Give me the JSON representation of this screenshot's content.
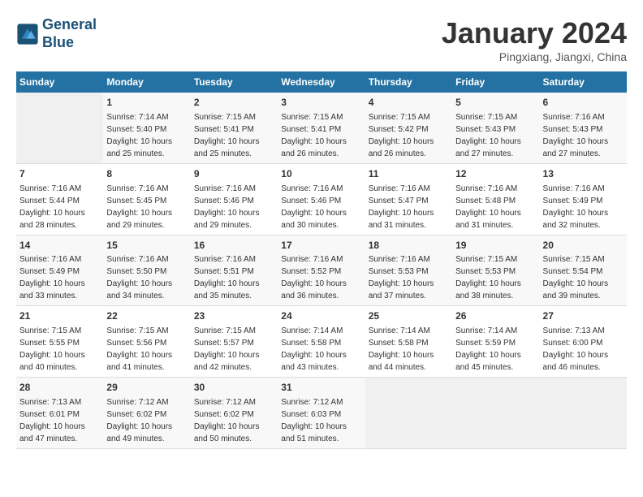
{
  "header": {
    "logo_line1": "General",
    "logo_line2": "Blue",
    "month": "January 2024",
    "location": "Pingxiang, Jiangxi, China"
  },
  "weekdays": [
    "Sunday",
    "Monday",
    "Tuesday",
    "Wednesday",
    "Thursday",
    "Friday",
    "Saturday"
  ],
  "weeks": [
    [
      {
        "day": "",
        "sunrise": "",
        "sunset": "",
        "daylight": ""
      },
      {
        "day": "1",
        "sunrise": "Sunrise: 7:14 AM",
        "sunset": "Sunset: 5:40 PM",
        "daylight": "Daylight: 10 hours and 25 minutes."
      },
      {
        "day": "2",
        "sunrise": "Sunrise: 7:15 AM",
        "sunset": "Sunset: 5:41 PM",
        "daylight": "Daylight: 10 hours and 25 minutes."
      },
      {
        "day": "3",
        "sunrise": "Sunrise: 7:15 AM",
        "sunset": "Sunset: 5:41 PM",
        "daylight": "Daylight: 10 hours and 26 minutes."
      },
      {
        "day": "4",
        "sunrise": "Sunrise: 7:15 AM",
        "sunset": "Sunset: 5:42 PM",
        "daylight": "Daylight: 10 hours and 26 minutes."
      },
      {
        "day": "5",
        "sunrise": "Sunrise: 7:15 AM",
        "sunset": "Sunset: 5:43 PM",
        "daylight": "Daylight: 10 hours and 27 minutes."
      },
      {
        "day": "6",
        "sunrise": "Sunrise: 7:16 AM",
        "sunset": "Sunset: 5:43 PM",
        "daylight": "Daylight: 10 hours and 27 minutes."
      }
    ],
    [
      {
        "day": "7",
        "sunrise": "Sunrise: 7:16 AM",
        "sunset": "Sunset: 5:44 PM",
        "daylight": "Daylight: 10 hours and 28 minutes."
      },
      {
        "day": "8",
        "sunrise": "Sunrise: 7:16 AM",
        "sunset": "Sunset: 5:45 PM",
        "daylight": "Daylight: 10 hours and 29 minutes."
      },
      {
        "day": "9",
        "sunrise": "Sunrise: 7:16 AM",
        "sunset": "Sunset: 5:46 PM",
        "daylight": "Daylight: 10 hours and 29 minutes."
      },
      {
        "day": "10",
        "sunrise": "Sunrise: 7:16 AM",
        "sunset": "Sunset: 5:46 PM",
        "daylight": "Daylight: 10 hours and 30 minutes."
      },
      {
        "day": "11",
        "sunrise": "Sunrise: 7:16 AM",
        "sunset": "Sunset: 5:47 PM",
        "daylight": "Daylight: 10 hours and 31 minutes."
      },
      {
        "day": "12",
        "sunrise": "Sunrise: 7:16 AM",
        "sunset": "Sunset: 5:48 PM",
        "daylight": "Daylight: 10 hours and 31 minutes."
      },
      {
        "day": "13",
        "sunrise": "Sunrise: 7:16 AM",
        "sunset": "Sunset: 5:49 PM",
        "daylight": "Daylight: 10 hours and 32 minutes."
      }
    ],
    [
      {
        "day": "14",
        "sunrise": "Sunrise: 7:16 AM",
        "sunset": "Sunset: 5:49 PM",
        "daylight": "Daylight: 10 hours and 33 minutes."
      },
      {
        "day": "15",
        "sunrise": "Sunrise: 7:16 AM",
        "sunset": "Sunset: 5:50 PM",
        "daylight": "Daylight: 10 hours and 34 minutes."
      },
      {
        "day": "16",
        "sunrise": "Sunrise: 7:16 AM",
        "sunset": "Sunset: 5:51 PM",
        "daylight": "Daylight: 10 hours and 35 minutes."
      },
      {
        "day": "17",
        "sunrise": "Sunrise: 7:16 AM",
        "sunset": "Sunset: 5:52 PM",
        "daylight": "Daylight: 10 hours and 36 minutes."
      },
      {
        "day": "18",
        "sunrise": "Sunrise: 7:16 AM",
        "sunset": "Sunset: 5:53 PM",
        "daylight": "Daylight: 10 hours and 37 minutes."
      },
      {
        "day": "19",
        "sunrise": "Sunrise: 7:15 AM",
        "sunset": "Sunset: 5:53 PM",
        "daylight": "Daylight: 10 hours and 38 minutes."
      },
      {
        "day": "20",
        "sunrise": "Sunrise: 7:15 AM",
        "sunset": "Sunset: 5:54 PM",
        "daylight": "Daylight: 10 hours and 39 minutes."
      }
    ],
    [
      {
        "day": "21",
        "sunrise": "Sunrise: 7:15 AM",
        "sunset": "Sunset: 5:55 PM",
        "daylight": "Daylight: 10 hours and 40 minutes."
      },
      {
        "day": "22",
        "sunrise": "Sunrise: 7:15 AM",
        "sunset": "Sunset: 5:56 PM",
        "daylight": "Daylight: 10 hours and 41 minutes."
      },
      {
        "day": "23",
        "sunrise": "Sunrise: 7:15 AM",
        "sunset": "Sunset: 5:57 PM",
        "daylight": "Daylight: 10 hours and 42 minutes."
      },
      {
        "day": "24",
        "sunrise": "Sunrise: 7:14 AM",
        "sunset": "Sunset: 5:58 PM",
        "daylight": "Daylight: 10 hours and 43 minutes."
      },
      {
        "day": "25",
        "sunrise": "Sunrise: 7:14 AM",
        "sunset": "Sunset: 5:58 PM",
        "daylight": "Daylight: 10 hours and 44 minutes."
      },
      {
        "day": "26",
        "sunrise": "Sunrise: 7:14 AM",
        "sunset": "Sunset: 5:59 PM",
        "daylight": "Daylight: 10 hours and 45 minutes."
      },
      {
        "day": "27",
        "sunrise": "Sunrise: 7:13 AM",
        "sunset": "Sunset: 6:00 PM",
        "daylight": "Daylight: 10 hours and 46 minutes."
      }
    ],
    [
      {
        "day": "28",
        "sunrise": "Sunrise: 7:13 AM",
        "sunset": "Sunset: 6:01 PM",
        "daylight": "Daylight: 10 hours and 47 minutes."
      },
      {
        "day": "29",
        "sunrise": "Sunrise: 7:12 AM",
        "sunset": "Sunset: 6:02 PM",
        "daylight": "Daylight: 10 hours and 49 minutes."
      },
      {
        "day": "30",
        "sunrise": "Sunrise: 7:12 AM",
        "sunset": "Sunset: 6:02 PM",
        "daylight": "Daylight: 10 hours and 50 minutes."
      },
      {
        "day": "31",
        "sunrise": "Sunrise: 7:12 AM",
        "sunset": "Sunset: 6:03 PM",
        "daylight": "Daylight: 10 hours and 51 minutes."
      },
      {
        "day": "",
        "sunrise": "",
        "sunset": "",
        "daylight": ""
      },
      {
        "day": "",
        "sunrise": "",
        "sunset": "",
        "daylight": ""
      },
      {
        "day": "",
        "sunrise": "",
        "sunset": "",
        "daylight": ""
      }
    ]
  ]
}
